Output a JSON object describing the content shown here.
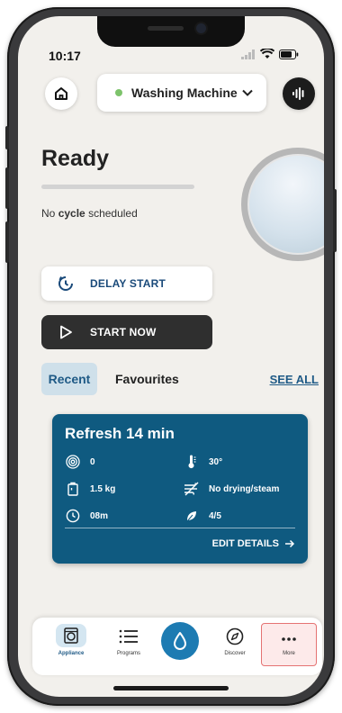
{
  "status_bar": {
    "time": "10:17"
  },
  "header": {
    "device_name": "Washing Machine",
    "device_status_color": "#7dc36b"
  },
  "appliance": {
    "state_title": "Ready",
    "progress": 0,
    "schedule_prefix": "No",
    "schedule_keyword": "cycle",
    "schedule_suffix": "scheduled"
  },
  "actions": {
    "delay_label": "DELAY START",
    "start_label": "START NOW"
  },
  "tabs": [
    {
      "label": "Recent",
      "selected": true
    },
    {
      "label": "Favourites",
      "selected": false
    }
  ],
  "see_all_label": "SEE ALL",
  "program_card": {
    "title": "Refresh 14 min",
    "specs": {
      "spin": "0",
      "temperature": "30°",
      "load": "1.5 kg",
      "drying": "No drying/steam",
      "duration": "08m",
      "eco": "4/5"
    },
    "edit_label": "EDIT DETAILS"
  },
  "bottom_nav": {
    "appliance": "Appliance",
    "programs": "Programs",
    "discover": "Discover",
    "more": "More"
  },
  "colors": {
    "accent": "#1d7bb2",
    "card": "#0f5a80",
    "link": "#1f5a86",
    "background": "#f2f0ec"
  }
}
